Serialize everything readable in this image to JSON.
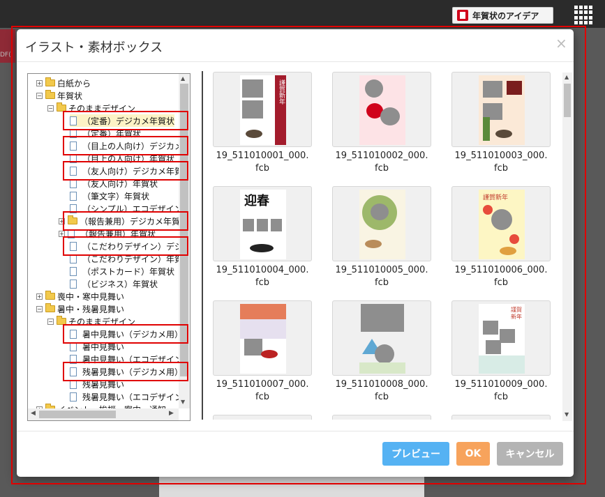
{
  "header": {
    "idea_button_label": "年賀状のアイデア"
  },
  "background": {
    "left_fragment": "DF("
  },
  "dialog": {
    "title": "イラスト・素材ボックス",
    "close_glyph": "×"
  },
  "tree": {
    "items": [
      {
        "label": "白紙から",
        "type": "folder",
        "expander": "+"
      },
      {
        "label": "年賀状",
        "type": "folder",
        "expander": "−"
      },
      {
        "label": "そのままデザイン",
        "type": "folder",
        "expander": "−"
      },
      {
        "label": "（定番）デジカメ年賀状",
        "type": "doc"
      },
      {
        "label": "（定番）年賀状",
        "type": "doc"
      },
      {
        "label": "（目上の人向け）デジカメ",
        "type": "doc"
      },
      {
        "label": "（目上の人向け）年賀状",
        "type": "doc"
      },
      {
        "label": "（友人向け）デジカメ年賀",
        "type": "doc"
      },
      {
        "label": "（友人向け）年賀状",
        "type": "doc"
      },
      {
        "label": "（筆文字）年賀状",
        "type": "doc"
      },
      {
        "label": "（シンプル）エコデザイン",
        "type": "doc"
      },
      {
        "label": "（報告兼用）デジカメ年賀",
        "type": "folder",
        "expander": "+"
      },
      {
        "label": "（報告兼用）年賀状",
        "type": "doc",
        "expander": "+"
      },
      {
        "label": "（こだわりデザイン）デジ",
        "type": "doc"
      },
      {
        "label": "（こだわりデザイン）年賀",
        "type": "doc"
      },
      {
        "label": "（ポストカード）年賀状",
        "type": "doc"
      },
      {
        "label": "（ビジネス）年賀状",
        "type": "doc"
      },
      {
        "label": "喪中・寒中見舞い",
        "type": "folder",
        "expander": "+"
      },
      {
        "label": "暑中・残暑見舞い",
        "type": "folder",
        "expander": "−"
      },
      {
        "label": "そのままデザイン",
        "type": "folder",
        "expander": "−"
      },
      {
        "label": "暑中見舞い（デジカメ用）",
        "type": "doc"
      },
      {
        "label": "暑中見舞い",
        "type": "doc"
      },
      {
        "label": "暑中見舞い（エコデザイン",
        "type": "doc"
      },
      {
        "label": "残暑見舞い（デジカメ用）",
        "type": "doc"
      },
      {
        "label": "残暑見舞い",
        "type": "doc"
      },
      {
        "label": "残暑見舞い（エコデザイン",
        "type": "doc"
      },
      {
        "label": "イベント・挨拶・案内・通知",
        "type": "folder",
        "expander": "+"
      }
    ]
  },
  "thumbnails": [
    {
      "name": "19_511010001_000.\nfcb"
    },
    {
      "name": "19_511010002_000.\nfcb"
    },
    {
      "name": "19_511010003_000.\nfcb"
    },
    {
      "name": "19_511010004_000.\nfcb"
    },
    {
      "name": "19_511010005_000.\nfcb"
    },
    {
      "name": "19_511010006_000.\nfcb"
    },
    {
      "name": "19_511010007_000.\nfcb"
    },
    {
      "name": "19_511010008_000.\nfcb"
    },
    {
      "name": "19_511010009_000.\nfcb"
    }
  ],
  "card_text": {
    "kinga_shinnen": "謹賀新年",
    "geishun": "迎春",
    "kinga_vertical": "謹賀新年"
  },
  "buttons": {
    "preview": "プレビュー",
    "ok": "OK",
    "cancel": "キャンセル"
  },
  "colors": {
    "accent_red": "#e00000",
    "preview": "#55b2f3",
    "ok": "#f7a35c",
    "cancel": "#b4b4b4"
  }
}
